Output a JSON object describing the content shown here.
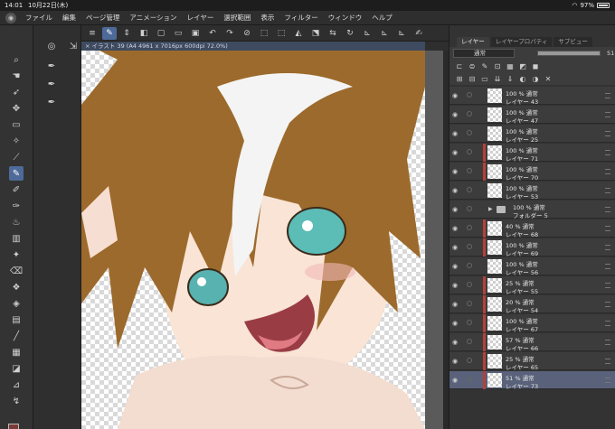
{
  "status": {
    "time": "14:01",
    "date": "10月22日(木)",
    "battery": "97%"
  },
  "menu": [
    "ファイル",
    "編集",
    "ページ管理",
    "アニメーション",
    "レイヤー",
    "選択範囲",
    "表示",
    "フィルター",
    "ウィンドウ",
    "ヘルプ"
  ],
  "canvas_tab": "× イラスト 39 (A4 4961 x 7016px 600dpi 72.0%)",
  "panel": {
    "tabs": [
      "レイヤー",
      "レイヤープロパティ",
      "サブビュー"
    ],
    "blend_mode": "通常",
    "opacity": "51"
  },
  "layers": [
    {
      "pct": "100 %",
      "mode": "通常",
      "name": "レイヤー 43",
      "clip": false,
      "folder": false,
      "sel": false
    },
    {
      "pct": "100 %",
      "mode": "通常",
      "name": "レイヤー 47",
      "clip": false,
      "folder": false,
      "sel": false
    },
    {
      "pct": "100 %",
      "mode": "通常",
      "name": "レイヤー 25",
      "clip": false,
      "folder": false,
      "sel": false
    },
    {
      "pct": "100 %",
      "mode": "通常",
      "name": "レイヤー 71",
      "clip": true,
      "folder": false,
      "sel": false
    },
    {
      "pct": "100 %",
      "mode": "通常",
      "name": "レイヤー 70",
      "clip": true,
      "folder": false,
      "sel": false
    },
    {
      "pct": "100 %",
      "mode": "通常",
      "name": "レイヤー 53",
      "clip": false,
      "folder": false,
      "sel": false
    },
    {
      "pct": "100 %",
      "mode": "通常",
      "name": "フォルダー 5",
      "clip": false,
      "folder": true,
      "sel": false
    },
    {
      "pct": "40 %",
      "mode": "通常",
      "name": "レイヤー 68",
      "clip": true,
      "folder": false,
      "sel": false
    },
    {
      "pct": "100 %",
      "mode": "通常",
      "name": "レイヤー 69",
      "clip": true,
      "folder": false,
      "sel": false
    },
    {
      "pct": "100 %",
      "mode": "通常",
      "name": "レイヤー 56",
      "clip": false,
      "folder": false,
      "sel": false
    },
    {
      "pct": "25 %",
      "mode": "通常",
      "name": "レイヤー 55",
      "clip": true,
      "folder": false,
      "sel": false
    },
    {
      "pct": "20 %",
      "mode": "通常",
      "name": "レイヤー 54",
      "clip": true,
      "folder": false,
      "sel": false
    },
    {
      "pct": "100 %",
      "mode": "通常",
      "name": "レイヤー 67",
      "clip": true,
      "folder": false,
      "sel": false
    },
    {
      "pct": "57 %",
      "mode": "通常",
      "name": "レイヤー 66",
      "clip": true,
      "folder": false,
      "sel": false
    },
    {
      "pct": "25 %",
      "mode": "通常",
      "name": "レイヤー 65",
      "clip": true,
      "folder": false,
      "sel": false
    },
    {
      "pct": "51 %",
      "mode": "通常",
      "name": "レイヤー 73",
      "clip": true,
      "folder": false,
      "sel": true
    }
  ]
}
